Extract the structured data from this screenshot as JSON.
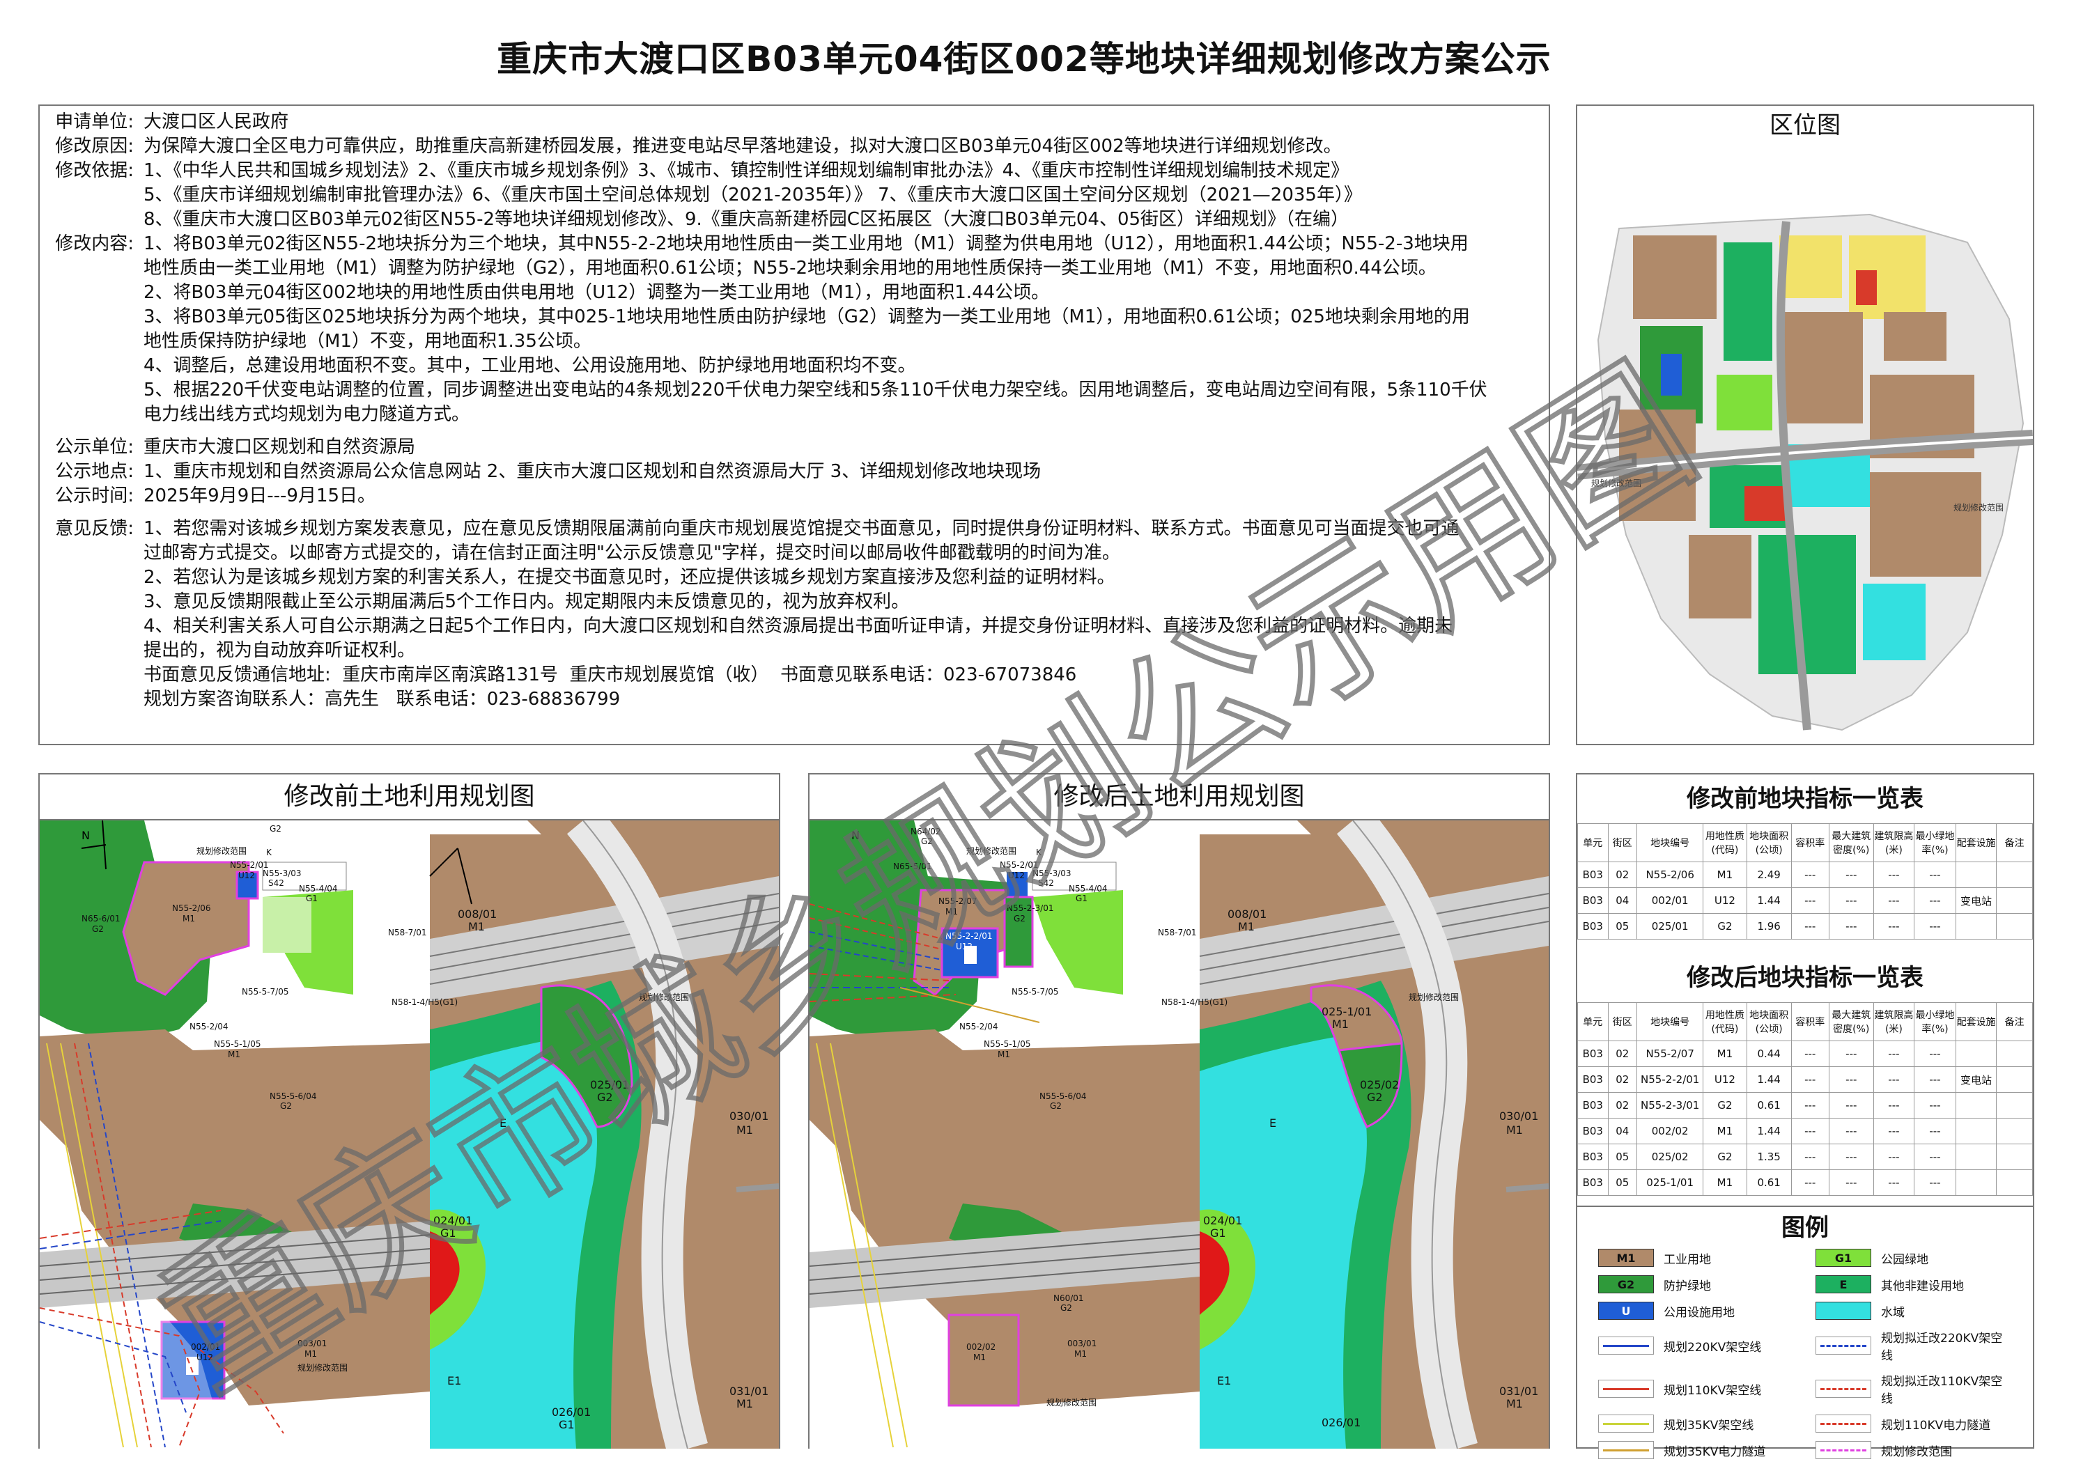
{
  "title": "重庆市大渡口区B03单元04街区002等地块详细规划修改方案公示",
  "info": {
    "applicant_label": "申请单位:",
    "applicant": "大渡口区人民政府",
    "reason_label": "修改原因:",
    "reason": "为保障大渡口全区电力可靠供应，助推重庆高新建桥园发展，推进变电站尽早落地建设，拟对大渡口区B03单元04街区002等地块进行详细规划修改。",
    "basis_label": "修改依据:",
    "basis": [
      "1、《中华人民共和国城乡规划法》2、《重庆市城乡规划条例》3、《城市、镇控制性详细规划编制审批办法》4、《重庆市控制性详细规划编制技术规定》",
      "5、《重庆市详细规划编制审批管理办法》6、《重庆市国土空间总体规划（2021-2035年）》 7、《重庆市大渡口区国土空间分区规划（2021—2035年）》",
      "8、《重庆市大渡口区B03单元02街区N55-2等地块详细规划修改》、9.《重庆高新建桥园C区拓展区（大渡口B03单元04、05街区）详细规划》（在编）"
    ],
    "content_label": "修改内容:",
    "content": [
      "1、将B03单元02街区N55-2地块拆分为三个地块，其中N55-2-2地块用地性质由一类工业用地（M1）调整为供电用地（U12），用地面积1.44公顷；N55-2-3地块用",
      "地性质由一类工业用地（M1）调整为防护绿地（G2），用地面积0.61公顷；N55-2地块剩余用地的用地性质保持一类工业用地（M1）不变，用地面积0.44公顷。",
      "2、将B03单元04街区002地块的用地性质由供电用地（U12）调整为一类工业用地（M1），用地面积1.44公顷。",
      "3、将B03单元05街区025地块拆分为两个地块，其中025-1地块用地性质由防护绿地（G2）调整为一类工业用地（M1），用地面积0.61公顷；025地块剩余用地的用",
      "地性质保持防护绿地（M1）不变，用地面积1.35公顷。",
      "4、调整后，总建设用地面积不变。其中，工业用地、公用设施用地、防护绿地用地面积均不变。",
      "5、根据220千伏变电站调整的位置，同步调整进出变电站的4条规划220千伏电力架空线和5条110千伏电力架空线。因用地调整后，变电站周边空间有限，5条110千伏",
      "电力线出线方式均规划为电力隧道方式。"
    ],
    "unit_label": "公示单位:",
    "unit": "重庆市大渡口区规划和自然资源局",
    "place_label": "公示地点:",
    "place": "1、重庆市规划和自然资源局公众信息网站 2、重庆市大渡口区规划和自然资源局大厅 3、详细规划修改地块现场",
    "time_label": "公示时间:",
    "time": "2025年9月9日---9月15日。",
    "feedback_label": "意见反馈:",
    "feedback": [
      "1、若您需对该城乡规划方案发表意见，应在意见反馈期限届满前向重庆市规划展览馆提交书面意见，同时提供身份证明材料、联系方式。书面意见可当面提交也可通",
      "过邮寄方式提交。以邮寄方式提交的，请在信封正面注明\"公示反馈意见\"字样，提交时间以邮局收件邮戳载明的时间为准。",
      "2、若您认为是该城乡规划方案的利害关系人，在提交书面意见时，还应提供该城乡规划方案直接涉及您利益的证明材料。",
      "3、意见反馈期限截止至公示期届满后5个工作日内。规定期限内未反馈意见的，视为放弃权利。",
      "4、相关利害关系人可自公示期满之日起5个工作日内，向大渡口区规划和自然资源局提出书面听证申请，并提交身份证明材料、直接涉及您利益的证明材料。逾期未",
      "提出的，视为自动放弃听证权利。"
    ],
    "mail_address": "书面意见反馈通信地址:  重庆市南岸区南滨路131号  重庆市规划展览馆（收）  书面意见联系电话：023-67073846",
    "contact": "规划方案咨询联系人：高先生   联系电话：023-68836799"
  },
  "location_map": {
    "title": "区位图",
    "label_left": "规划修改范围",
    "label_right": "规划修改范围"
  },
  "before_map": {
    "title": "修改前土地利用规划图",
    "labels": {
      "boundary_top": "规划修改范围",
      "boundary_mid": "规划修改范围",
      "boundary_bottom": "规划修改范围",
      "n552_code": "N55-2/01",
      "n552_use": "U12",
      "n553": "N55-3/03",
      "n553_use": "S42",
      "n554": "N55-4/04",
      "n554_use": "G1",
      "n552b": "N55-2/06",
      "n552b_use": "M1",
      "n656": "N65-6/01",
      "n656_use": "G2",
      "n557": "N55-5-7/05",
      "n552c": "N55-2/04",
      "n5551": "N55-5-1/05",
      "n5551_use": "M1",
      "n5565": "N55-5-6/04",
      "n5565_use": "G2",
      "n587": "N58-7/01",
      "n581": "N58-1-4/H5(G1)",
      "g2_top": "G2",
      "k_top": "K",
      "b008": "008/01",
      "b008_use": "M1",
      "b030": "030/01",
      "b030_use": "M1",
      "b025": "025/01",
      "b025_use": "G2",
      "e_mid": "E",
      "b024": "024/01",
      "b024_use": "G1",
      "b002": "002/01",
      "b002_use": "U12",
      "b003": "003/01",
      "b003_use": "M1",
      "e1": "E1",
      "b026": "026/01",
      "b026_use": "G1",
      "b031": "031/01",
      "b031_use": "M1"
    }
  },
  "after_map": {
    "title": "修改后土地利用规划图",
    "labels": {
      "boundary_top": "规划修改范围",
      "boundary_mid": "规划修改范围",
      "boundary_bottom": "规划修改范围",
      "n642": "N64/02",
      "n642_use": "G2",
      "n651": "N65-5/01",
      "n652": "N55-2/07",
      "n652_use": "M1",
      "n5521": "N55-2/01",
      "n5521_use": "U12",
      "n553": "N55-3/03",
      "n553_use": "S42",
      "n5522": "N55-2-2/01",
      "n5522_use": "U12",
      "n5523": "N55-2-3/01",
      "n5523_use": "G2",
      "n554": "N55-4/04",
      "n554_use": "G1",
      "n557": "N55-5-7/05",
      "n552c": "N55-2/04",
      "n5551": "N55-5-1/05",
      "n5551_use": "M1",
      "n5565": "N55-5-6/04",
      "n5565_use": "G2",
      "n587": "N58-7/01",
      "n581": "N58-1-4/H5(G1)",
      "k_top": "K",
      "a008": "008/01",
      "a008_use": "M1",
      "a030": "030/01",
      "a030_use": "M1",
      "a0251": "025-1/01",
      "a0251_use": "M1",
      "a0252": "025/02",
      "a0252_use": "G2",
      "e_mid": "E",
      "a024": "024/01",
      "a024_use": "G1",
      "n601": "N60/01",
      "n601_use": "G2",
      "a002": "002/02",
      "a002_use": "M1",
      "a003": "003/01",
      "a003_use": "M1",
      "e1": "E1",
      "a026": "026/01",
      "a031": "031/01",
      "a031_use": "M1"
    }
  },
  "table_before": {
    "title": "修改前地块指标一览表",
    "headers": [
      "单元",
      "街区",
      "地块编号",
      "用地性质(代码)",
      "地块面积(公顷)",
      "容积率",
      "最大建筑密度(%)",
      "建筑限高(米)",
      "最小绿地率(%)",
      "配套设施",
      "备注"
    ],
    "rows": [
      [
        "B03",
        "02",
        "N55-2/06",
        "M1",
        "2.49",
        "---",
        "---",
        "---",
        "---",
        "",
        ""
      ],
      [
        "B03",
        "04",
        "002/01",
        "U12",
        "1.44",
        "---",
        "---",
        "---",
        "---",
        "变电站",
        ""
      ],
      [
        "B03",
        "05",
        "025/01",
        "G2",
        "1.96",
        "---",
        "---",
        "---",
        "---",
        "",
        ""
      ]
    ]
  },
  "table_after": {
    "title": "修改后地块指标一览表",
    "headers": [
      "单元",
      "街区",
      "地块编号",
      "用地性质(代码)",
      "地块面积(公顷)",
      "容积率",
      "最大建筑密度(%)",
      "建筑限高(米)",
      "最小绿地率(%)",
      "配套设施",
      "备注"
    ],
    "rows": [
      [
        "B03",
        "02",
        "N55-2/07",
        "M1",
        "0.44",
        "---",
        "---",
        "---",
        "---",
        "",
        ""
      ],
      [
        "B03",
        "02",
        "N55-2-2/01",
        "U12",
        "1.44",
        "---",
        "---",
        "---",
        "---",
        "变电站",
        ""
      ],
      [
        "B03",
        "02",
        "N55-2-3/01",
        "G2",
        "0.61",
        "---",
        "---",
        "---",
        "---",
        "",
        ""
      ],
      [
        "B03",
        "04",
        "002/02",
        "M1",
        "1.44",
        "---",
        "---",
        "---",
        "---",
        "",
        ""
      ],
      [
        "B03",
        "05",
        "025/02",
        "G2",
        "1.35",
        "---",
        "---",
        "---",
        "---",
        "",
        ""
      ],
      [
        "B03",
        "05",
        "025-1/01",
        "M1",
        "0.61",
        "---",
        "---",
        "---",
        "---",
        "",
        ""
      ]
    ]
  },
  "legend": {
    "title": "图例",
    "items": [
      {
        "code": "M1",
        "label": "工业用地",
        "color": "#b08a6a"
      },
      {
        "code": "G1",
        "label": "公园绿地",
        "color": "#7fe03a"
      },
      {
        "code": "G2",
        "label": "防护绿地",
        "color": "#2f9a3a"
      },
      {
        "code": "E",
        "label": "其他非建设用地",
        "color": "#1db060"
      },
      {
        "code": "U",
        "label": "公用设施用地",
        "color": "#1f5ed6"
      },
      {
        "code": "",
        "label": "水域",
        "color": "#33e0e0"
      },
      {
        "code": "",
        "label": "规划220KV架空线",
        "color": "#2446c8"
      },
      {
        "code": "",
        "label": "规划拟迁改220KV架空线",
        "color": "#2446c8"
      },
      {
        "code": "",
        "label": "规划110KV架空线",
        "color": "#d83a2a"
      },
      {
        "code": "",
        "label": "规划拟迁改110KV架空线",
        "color": "#d83a2a"
      },
      {
        "code": "",
        "label": "规划35KV架空线",
        "color": "#c9d43a"
      },
      {
        "code": "",
        "label": "规划110KV电力隧道",
        "color": "#d83a2a"
      },
      {
        "code": "",
        "label": "规划35KV电力隧道",
        "color": "#d0a030"
      },
      {
        "code": "",
        "label": "规划修改范围",
        "color": "#e040e0"
      }
    ]
  },
  "watermark": "重庆市城乡规划公示用图",
  "colors": {
    "m1": "#b08a6a",
    "g1": "#7fe03a",
    "g2": "#2f9a3a",
    "e": "#1db060",
    "u": "#1f5ed6",
    "water": "#33e0e0",
    "boundary": "#e040e0",
    "red": "#e01818"
  }
}
